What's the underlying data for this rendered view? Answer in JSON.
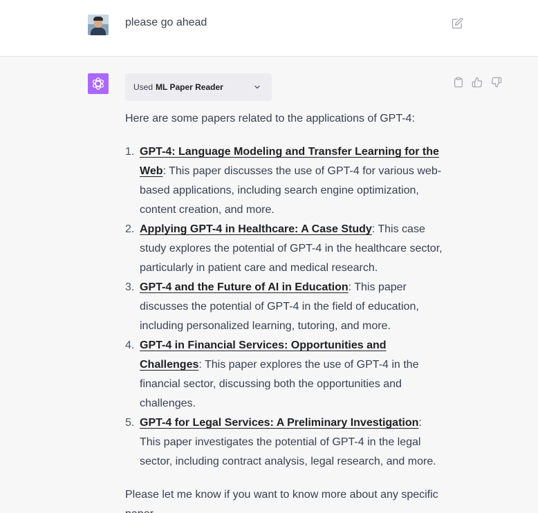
{
  "user_message": {
    "avatar": "user-photo-avatar",
    "text": "please go ahead",
    "edit_icon": "edit-icon"
  },
  "assistant": {
    "logo": "openai-logo-icon",
    "logo_color": "#ab68ff",
    "plugin": {
      "prefix": "Used",
      "name": "ML Paper Reader",
      "expand_icon": "chevron-down-icon"
    },
    "actions": {
      "copy_icon": "clipboard-icon",
      "like_icon": "thumbs-up-icon",
      "dislike_icon": "thumbs-down-icon"
    },
    "intro": "Here are some papers related to the applications of GPT-4:",
    "papers": [
      {
        "number": "1.",
        "title": "GPT-4: Language Modeling and Transfer Learning for the Web",
        "description": ": This paper discusses the use of GPT-4 for various web-based applications, including search engine optimization, content creation, and more."
      },
      {
        "number": "2.",
        "title": "Applying GPT-4 in Healthcare: A Case Study",
        "description": ": This case study explores the potential of GPT-4 in the healthcare sector, particularly in patient care and medical research."
      },
      {
        "number": "3.",
        "title": "GPT-4 and the Future of AI in Education",
        "description": ": This paper discusses the potential of GPT-4 in the field of education, including personalized learning, tutoring, and more."
      },
      {
        "number": "4.",
        "title": "GPT-4 in Financial Services: Opportunities and Challenges",
        "description": ": This paper explores the use of GPT-4 in the financial sector, discussing both the opportunities and challenges."
      },
      {
        "number": "5.",
        "title": "GPT-4 for Legal Services: A Preliminary Investigation",
        "description": ": This paper investigates the potential of GPT-4 in the legal sector, including contract analysis, legal research, and more."
      }
    ],
    "outro": "Please let me know if you want to know more about any specific paper."
  }
}
